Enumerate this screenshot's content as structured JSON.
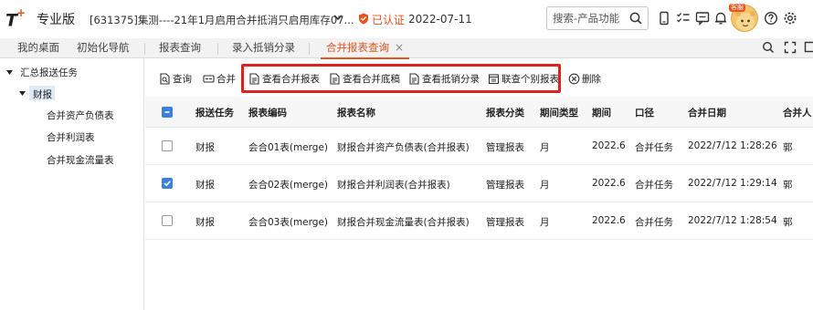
{
  "header": {
    "logo": "T",
    "logo_plus": "+",
    "edition": "专业版",
    "company": "[631375]集测----21年1月启用合并抵消只启用库存07...",
    "cert_status": "已认证",
    "date": "2022-07-11",
    "search_placeholder": "搜索-产品功能",
    "avatar_badge": "客服",
    "icons": [
      "mobile-icon",
      "checklist-icon",
      "message-icon",
      "bell-icon",
      "help-icon",
      "settings-icon"
    ],
    "colors": {
      "accent": "#e8541e",
      "highlight": "#d9251c",
      "checkbox": "#3b7fe0"
    }
  },
  "tabs": [
    {
      "label": "我的桌面",
      "active": false
    },
    {
      "label": "初始化导航",
      "active": false
    },
    {
      "label": "报表查询",
      "active": false
    },
    {
      "label": "录入抵销分录",
      "active": false
    },
    {
      "label": "合并报表查询",
      "active": true
    }
  ],
  "tab_close": "×",
  "sidebar": {
    "root": "汇总报送任务",
    "group": "财报",
    "items": [
      "合并资产负债表",
      "合并利润表",
      "合并现金流量表"
    ]
  },
  "toolbar": {
    "query": "查询",
    "merge": "合并",
    "view_merged": "查看合并报表",
    "view_draft": "查看合并底稿",
    "view_offset": "查看抵销分录",
    "joint_query": "联查个别报表",
    "delete": "删除"
  },
  "table": {
    "columns": [
      "报送任务",
      "报表编码",
      "报表名称",
      "报表分类",
      "期间类型",
      "期间",
      "口径",
      "合并日期",
      "合并人"
    ],
    "header_checkbox": "partial",
    "rows": [
      {
        "checked": false,
        "task": "财报",
        "code": "会合01表(merge)",
        "name": "财报合并资产负债表(合并报表)",
        "category": "管理报表",
        "period_type": "月",
        "period": "2022.6",
        "scope": "合并任务",
        "date": "2022/7/12 1:28:26",
        "user": "郭"
      },
      {
        "checked": true,
        "task": "财报",
        "code": "会合02表(merge)",
        "name": "财报合并利润表(合并报表)",
        "category": "管理报表",
        "period_type": "月",
        "period": "2022.6",
        "scope": "合并任务",
        "date": "2022/7/12 1:29:14",
        "user": "郭"
      },
      {
        "checked": false,
        "task": "财报",
        "code": "会合03表(merge)",
        "name": "财报合并现金流量表(合并报表)",
        "category": "管理报表",
        "period_type": "月",
        "period": "2022.6",
        "scope": "合并任务",
        "date": "2022/7/12 1:28:54",
        "user": "郭"
      }
    ]
  }
}
